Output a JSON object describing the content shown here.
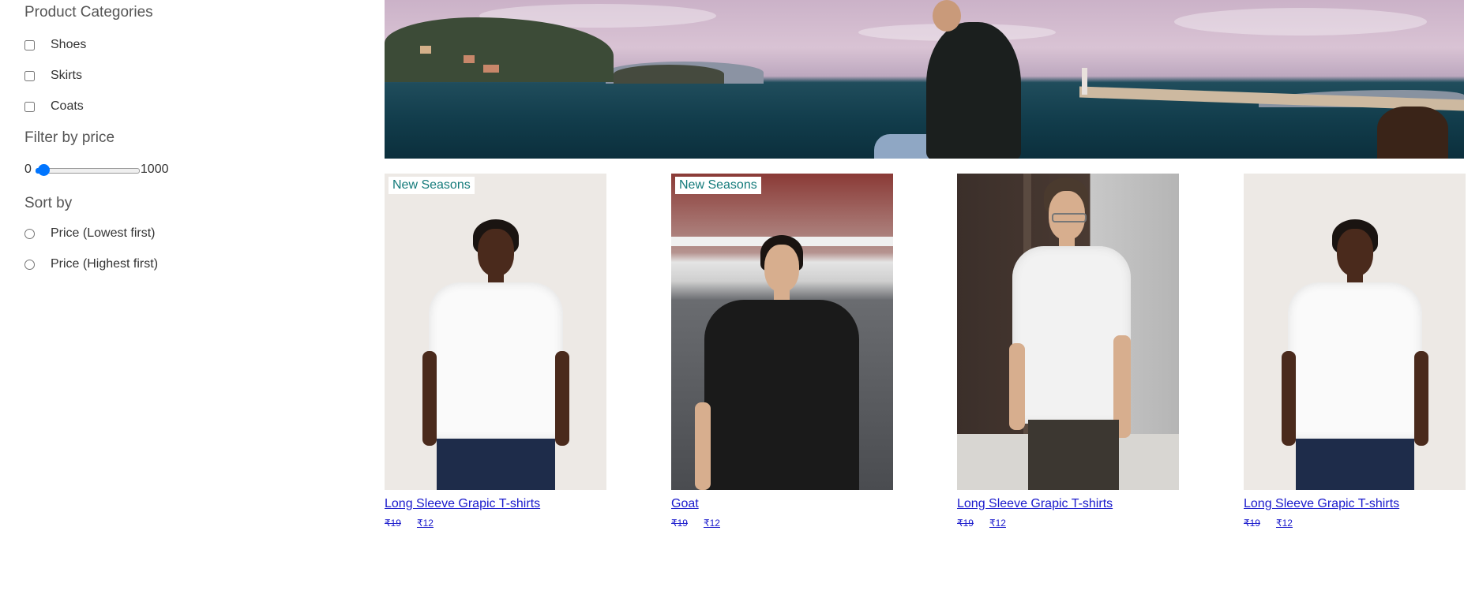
{
  "sidebar": {
    "categories_heading": "Product Categories",
    "categories": [
      {
        "label": "Shoes",
        "checked": false
      },
      {
        "label": "Skirts",
        "checked": false
      },
      {
        "label": "Coats",
        "checked": false
      }
    ],
    "price_heading": "Filter by price",
    "price_min": "0",
    "price_max": "1000",
    "price_value": 0,
    "sort_heading": "Sort by",
    "sort_options": [
      {
        "label": "Price (Lowest first)",
        "selected": false
      },
      {
        "label": "Price (Highest first)",
        "selected": false
      }
    ]
  },
  "products": [
    {
      "badge": "New Seasons",
      "title": "Long Sleeve Grapic T-shirts",
      "old_price": "₹19",
      "price": "₹12"
    },
    {
      "badge": "New Seasons",
      "title": "Goat",
      "old_price": "₹19",
      "price": "₹12"
    },
    {
      "badge": "",
      "title": "Long Sleeve Grapic T-shirts",
      "old_price": "₹19",
      "price": "₹12"
    },
    {
      "badge": "",
      "title": "Long Sleeve Grapic T-shirts",
      "old_price": "₹19",
      "price": "₹12"
    }
  ],
  "colors": {
    "accent": "#0075ff",
    "link": "#1a1acc",
    "badge_text": "#137a7a"
  }
}
